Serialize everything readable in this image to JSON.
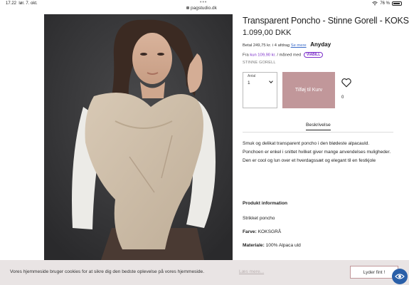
{
  "status_bar": {
    "time": "17.22",
    "date": "lør. 7. okt.",
    "url": "pagstudio.dk",
    "battery": "76 %"
  },
  "product": {
    "title": "Transparent Poncho - Stinne Gorell - KOKSGRÅ",
    "price": "1.099,00 DKK",
    "anyday_text": "Betal 249,75 kr. i 4 afdrag",
    "anyday_link": "Se mere",
    "anyday_logo": "Anyday",
    "viabill_prefix": "Fra",
    "viabill_amount": "kun 109,90 kr.",
    "viabill_suffix": "/ måned med",
    "viabill_logo": "VIABILL",
    "brand": "STINNE GORELL",
    "quantity_label": "Antal",
    "quantity_value": "1",
    "add_to_cart": "Tilføj til Kurv",
    "wishlist_count": "0"
  },
  "tabs": {
    "description": "Beskrivelse"
  },
  "description": {
    "line1": "Smuk og delikat transparent poncho i den blødeste alpacauld.",
    "line2": "Ponchoen er enkel i snittet hvilket giver mange anvendelses muligheder.",
    "line3": "Den er cool og lun over et hverdagssæt og elegant til en festkjole"
  },
  "info": {
    "title": "Produkt information",
    "type": "Strikket poncho",
    "color_label": "Farve:",
    "color_value": "KOKSGRÅ",
    "material_label": "Materiale:",
    "material_value": "100% Alpaca uld"
  },
  "cookie": {
    "text": "Vores hjemmeside bruger cookies for at sikre dig den bedste oplevelse på vores hjemmeside.",
    "link": "Læs mere...",
    "button": "Lyder fint !"
  },
  "colors": {
    "accent": "#c1979a",
    "cookie_bg": "#e9e4e4",
    "accessibility": "#2a5fa8"
  }
}
